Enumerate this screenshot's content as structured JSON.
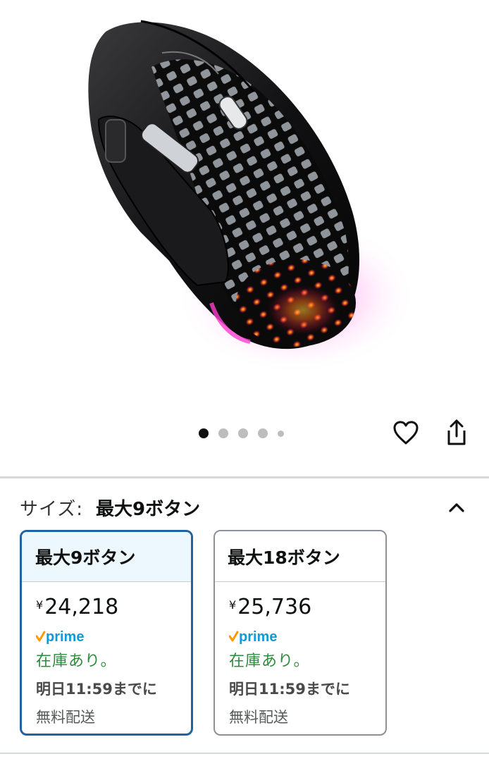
{
  "product_image": {
    "alt": ""
  },
  "carousel": {
    "count": 5,
    "active_index": 0
  },
  "size_selector": {
    "label": "サイズ:",
    "selected_value": "最大9ボタン"
  },
  "options": [
    {
      "name": "最大9ボタン",
      "currency": "¥",
      "price": "24,218",
      "prime_label": "prime",
      "stock": "在庫あり。",
      "delivery": "明日11:59までに",
      "shipping": "無料配送",
      "selected": true
    },
    {
      "name": "最大18ボタン",
      "currency": "¥",
      "price": "25,736",
      "prime_label": "prime",
      "stock": "在庫あり。",
      "delivery": "明日11:59までに",
      "shipping": "無料配送",
      "selected": false
    }
  ],
  "icons": {
    "heart": "heart-icon",
    "share": "share-icon",
    "collapse": "chevron-up-icon",
    "prime": "prime-check-icon"
  },
  "colors": {
    "selected_border": "#2162a1",
    "selected_header_bg": "#edf7fe",
    "stock_green": "#2f8a3c",
    "prime_blue": "#1399d5",
    "prime_orange": "#ff9900"
  }
}
